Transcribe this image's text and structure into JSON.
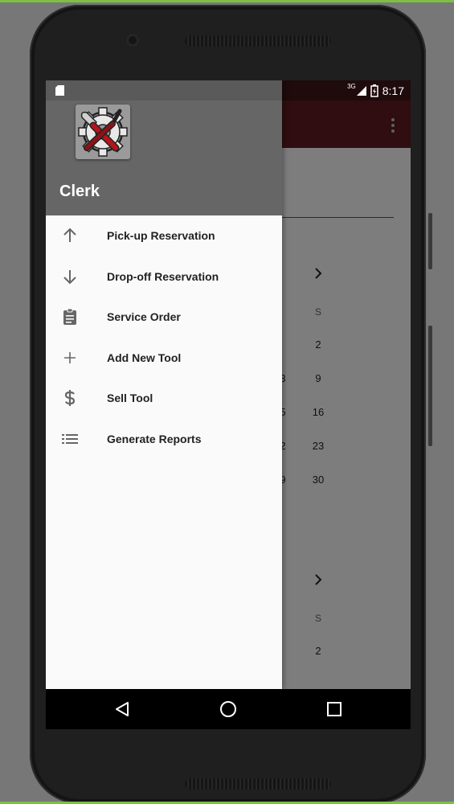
{
  "status_bar": {
    "network": "3G",
    "time": "8:17"
  },
  "drawer": {
    "title": "Clerk",
    "items": [
      {
        "label": "Pick-up Reservation",
        "icon": "arrow-up-icon"
      },
      {
        "label": "Drop-off Reservation",
        "icon": "arrow-down-icon"
      },
      {
        "label": "Service Order",
        "icon": "clipboard-icon"
      },
      {
        "label": "Add New Tool",
        "icon": "plus-icon"
      },
      {
        "label": "Sell Tool",
        "icon": "dollar-icon"
      },
      {
        "label": "Generate Reports",
        "icon": "list-icon"
      }
    ]
  },
  "calendar": {
    "first": {
      "day_header": "S",
      "dates": [
        "2",
        "9",
        "16",
        "23",
        "30"
      ],
      "partial": [
        "3",
        "5",
        "2",
        "9"
      ]
    },
    "second": {
      "day_header": "S",
      "dates": [
        "2"
      ]
    }
  },
  "colors": {
    "app_bar": "#5e1b21",
    "status_bar": "#3f1418",
    "drawer_header": "#666666"
  }
}
